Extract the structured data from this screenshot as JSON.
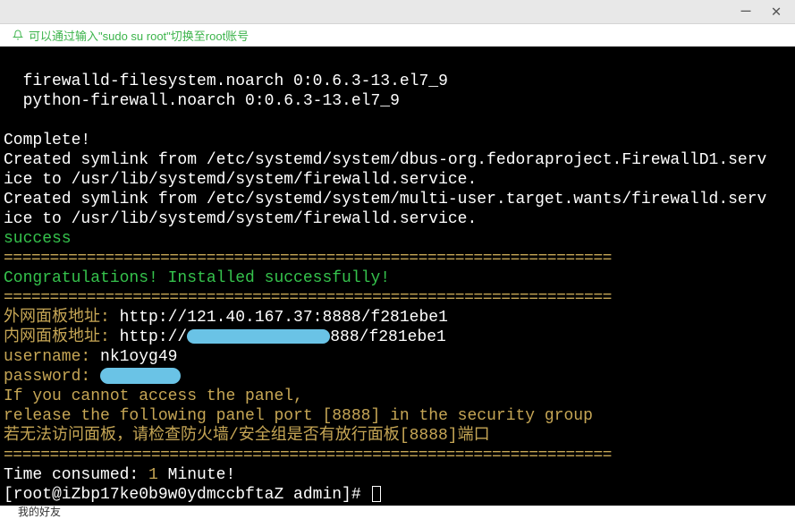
{
  "titlebar": {
    "minimize": "—",
    "close": "✕"
  },
  "hint": {
    "text": "可以通过输入\"sudo su root\"切换至root账号"
  },
  "terminal": {
    "pkg1": "  firewalld-filesystem.noarch 0:0.6.3-13.el7_9",
    "pkg2": "  python-firewall.noarch 0:0.6.3-13.el7_9",
    "complete": "Complete!",
    "symlink1a": "Created symlink from /etc/systemd/system/dbus-org.fedoraproject.FirewallD1.serv",
    "symlink1b": "ice to /usr/lib/systemd/system/firewalld.service.",
    "symlink2a": "Created symlink from /etc/systemd/system/multi-user.target.wants/firewalld.serv",
    "symlink2b": "ice to /usr/lib/systemd/system/firewalld.service.",
    "success": "success",
    "sep": "==================================================================",
    "congrats": "Congratulations! Installed successfully!",
    "url_external_label": "外网面板地址: ",
    "url_external_value": "http://121.40.167.37:8888/f281ebe1",
    "url_internal_label": "内网面板地址: ",
    "url_internal_prefix": "http://",
    "url_internal_suffix": "888/f281ebe1",
    "username_label": "username: ",
    "username_value": "nk1oyg49",
    "password_label": "password: ",
    "warn1": "If you cannot access the panel,",
    "warn2": "release the following panel port [8888] in the security group",
    "warn3": "若无法访问面板，请检查防火墙/安全组是否有放行面板[8888]端口",
    "time_line": "Time consumed: ",
    "time_value": "1",
    "time_suffix": " Minute!",
    "prompt": "[root@iZbp17ke0b9w0ydmccbftaZ admin]# "
  },
  "bottom": {
    "text": "我的好友"
  }
}
